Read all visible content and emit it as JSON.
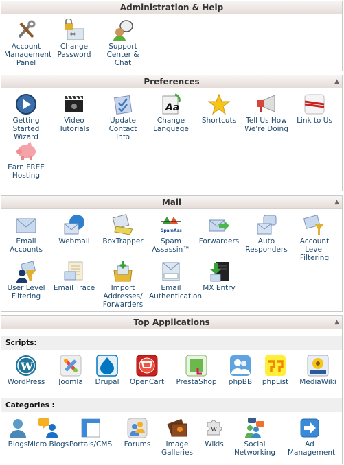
{
  "admin": {
    "title": "Administration & Help",
    "items": [
      {
        "label": "Account Management Panel",
        "icon": "tools-icon"
      },
      {
        "label": "Change Password",
        "icon": "lock-password-icon"
      },
      {
        "label": "Support Center & Chat",
        "icon": "support-chat-icon"
      }
    ]
  },
  "prefs": {
    "title": "Preferences",
    "items": [
      {
        "label": "Getting Started Wizard",
        "icon": "play-icon"
      },
      {
        "label": "Video Tutorials",
        "icon": "clapperboard-icon"
      },
      {
        "label": "Update Contact Info",
        "icon": "contact-info-icon"
      },
      {
        "label": "Change Language",
        "icon": "language-icon"
      },
      {
        "label": "Shortcuts",
        "icon": "star-icon"
      },
      {
        "label": "Tell Us How We're Doing",
        "icon": "megaphone-icon"
      },
      {
        "label": "Link to Us",
        "icon": "link-icon"
      },
      {
        "label": "Earn FREE Hosting",
        "icon": "piggy-bank-icon"
      }
    ]
  },
  "mail": {
    "title": "Mail",
    "items": [
      {
        "label": "Email Accounts",
        "icon": "envelope-icon"
      },
      {
        "label": "Webmail",
        "icon": "webmail-icon"
      },
      {
        "label": "BoxTrapper",
        "icon": "boxtrapper-icon"
      },
      {
        "label": "Spam Assassin™",
        "icon": "spamassassin-icon"
      },
      {
        "label": "Forwarders",
        "icon": "forwarders-icon"
      },
      {
        "label": "Auto Responders",
        "icon": "autoresponder-icon"
      },
      {
        "label": "Account Level Filtering",
        "icon": "filter-icon"
      },
      {
        "label": "User Level Filtering",
        "icon": "user-filter-icon"
      },
      {
        "label": "Email Trace",
        "icon": "email-trace-icon"
      },
      {
        "label": "Import Addresses/ Forwarders",
        "icon": "import-icon"
      },
      {
        "label": "Email Authentication",
        "icon": "email-auth-icon"
      },
      {
        "label": "MX Entry",
        "icon": "mx-server-icon"
      }
    ]
  },
  "apps": {
    "title": "Top Applications",
    "scripts_label": "Scripts:",
    "scripts": [
      {
        "label": "WordPress",
        "icon": "wordpress-icon"
      },
      {
        "label": "Joomla",
        "icon": "joomla-icon"
      },
      {
        "label": "Drupal",
        "icon": "drupal-icon"
      },
      {
        "label": "OpenCart",
        "icon": "opencart-icon"
      },
      {
        "label": "PrestaShop",
        "icon": "prestashop-icon"
      },
      {
        "label": "phpBB",
        "icon": "phpbb-icon"
      },
      {
        "label": "phpList",
        "icon": "phplist-icon"
      },
      {
        "label": "MediaWiki",
        "icon": "mediawiki-icon"
      }
    ],
    "categories_label": "Categories :",
    "categories": [
      {
        "label": "Blogs",
        "icon": "blogs-icon"
      },
      {
        "label": "Micro Blogs",
        "icon": "micro-blogs-icon"
      },
      {
        "label": "Portals/CMS",
        "icon": "portals-icon"
      },
      {
        "label": "Forums",
        "icon": "forums-icon"
      },
      {
        "label": "Image Galleries",
        "icon": "image-galleries-icon"
      },
      {
        "label": "Wikis",
        "icon": "wikis-icon"
      },
      {
        "label": "Social Networking",
        "icon": "social-networking-icon"
      },
      {
        "label": "Ad Management",
        "icon": "ad-management-icon"
      }
    ]
  },
  "toggle_glyph": "▲"
}
